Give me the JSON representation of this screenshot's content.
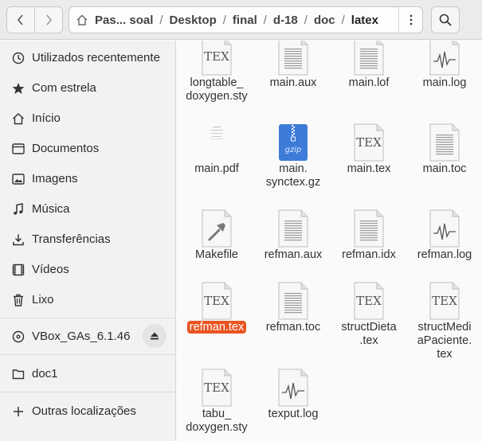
{
  "header": {
    "back_icon": "go-back-icon",
    "forward_icon": "go-forward-icon",
    "home_icon": "home-icon",
    "breadcrumbs": [
      "Pas... soal",
      "Desktop",
      "final",
      "d-18",
      "doc",
      "latex"
    ],
    "separator": "/",
    "menu_icon": "vertical-dots-icon",
    "search_icon": "search-icon"
  },
  "sidebar": {
    "items": [
      {
        "label": "Utilizados recentemente",
        "icon": "clock-icon"
      },
      {
        "label": "Com estrela",
        "icon": "star-icon"
      },
      {
        "label": "Início",
        "icon": "home-icon"
      },
      {
        "label": "Documentos",
        "icon": "document-icon"
      },
      {
        "label": "Imagens",
        "icon": "image-icon"
      },
      {
        "label": "Música",
        "icon": "music-icon"
      },
      {
        "label": "Transferências",
        "icon": "download-icon"
      },
      {
        "label": "Vídeos",
        "icon": "video-icon"
      },
      {
        "label": "Lixo",
        "icon": "trash-icon"
      },
      {
        "label": "VBox_GAs_6.1.46",
        "icon": "disc-icon",
        "eject_icon": "eject-icon"
      },
      {
        "label": "doc1",
        "icon": "folder-icon"
      },
      {
        "label": "Outras localizações",
        "icon": "plus-icon"
      }
    ]
  },
  "files": [
    {
      "name": "longtable_\ndoxygen.sty",
      "type": "tex"
    },
    {
      "name": "main.aux",
      "type": "text"
    },
    {
      "name": "main.lof",
      "type": "text"
    },
    {
      "name": "main.log",
      "type": "log"
    },
    {
      "name": "main.pdf",
      "type": "pdf"
    },
    {
      "name": "main.\nsynctex.gz",
      "type": "gzip",
      "icon_label": "gzip"
    },
    {
      "name": "main.tex",
      "type": "tex"
    },
    {
      "name": "main.toc",
      "type": "text"
    },
    {
      "name": "Makefile",
      "type": "makefile"
    },
    {
      "name": "refman.aux",
      "type": "text"
    },
    {
      "name": "refman.idx",
      "type": "text"
    },
    {
      "name": "refman.log",
      "type": "log"
    },
    {
      "name": "refman.tex",
      "type": "tex",
      "selected": true
    },
    {
      "name": "refman.toc",
      "type": "text"
    },
    {
      "name": "structDieta\n.tex",
      "type": "tex"
    },
    {
      "name": "structMedi\naPaciente.\ntex",
      "type": "tex"
    },
    {
      "name": "tabu_\ndoxygen.sty",
      "type": "tex"
    },
    {
      "name": "texput.log",
      "type": "log"
    }
  ],
  "colors": {
    "selection": "#e95420",
    "gzip_blue": "#3d7bd9"
  },
  "tex_logo": "TEX"
}
